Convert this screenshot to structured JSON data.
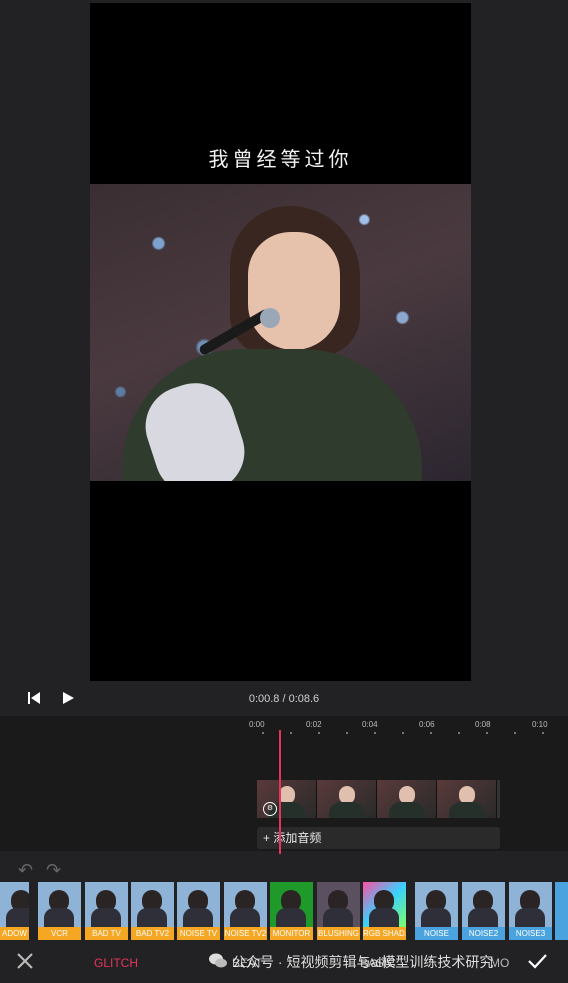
{
  "preview": {
    "caption": "我曾经等过你"
  },
  "controls": {
    "timecode": "0:00.8 / 0:08.6"
  },
  "timeline": {
    "ticks": [
      "0:00",
      "0:02",
      "0:04",
      "0:06",
      "0:08",
      "0:10"
    ],
    "add_audio": "+ 添加音频"
  },
  "effects": [
    {
      "label": "ADOW",
      "color": "#f5a623"
    },
    {
      "label": "VCR",
      "color": "#f5a623"
    },
    {
      "label": "BAD TV",
      "color": "#f5a623"
    },
    {
      "label": "BAD TV2",
      "color": "#f5a623"
    },
    {
      "label": "NOISE TV",
      "color": "#f5a623"
    },
    {
      "label": "NOISE TV2",
      "color": "#f5a623"
    },
    {
      "label": "MONITOR",
      "color": "#f5a623"
    },
    {
      "label": "BLUSHING",
      "color": "#f5a623"
    },
    {
      "label": "RGB SHAD...",
      "color": "#f5a623"
    },
    {
      "label": "NOISE",
      "color": "#4aa3df"
    },
    {
      "label": "NOISE2",
      "color": "#4aa3df"
    },
    {
      "label": "NOISE3",
      "color": "#4aa3df"
    }
  ],
  "bottom_bar": {
    "tabs": [
      {
        "label": "GLITCH",
        "color": "#e8345b"
      },
      {
        "label": "BEAT",
        "color": "#bbbbbb"
      },
      {
        "label": "BASIC",
        "color": "#bbbbbb"
      },
      {
        "label": "MO",
        "color": "#bbbbbb"
      }
    ],
    "watermark": "公众号 · 短视频剪辑与ai模型训练技术研究"
  },
  "colors": {
    "accent": "#e8345b",
    "glitch_label": "#f5a623",
    "noise_label": "#4aa3df"
  }
}
